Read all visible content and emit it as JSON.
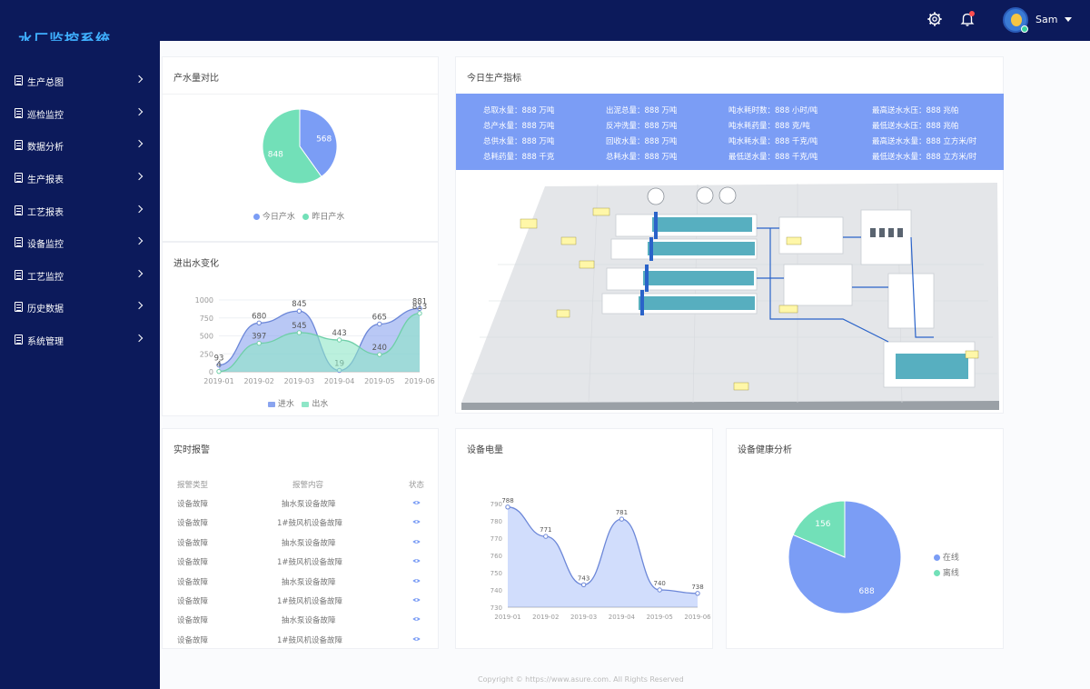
{
  "app": {
    "title": "水厂监控系统"
  },
  "header": {
    "user_name": "Sam"
  },
  "sidebar": {
    "items": [
      {
        "label": "生产总图"
      },
      {
        "label": "巡检监控"
      },
      {
        "label": "数据分析"
      },
      {
        "label": "生产报表"
      },
      {
        "label": "工艺报表"
      },
      {
        "label": "设备监控"
      },
      {
        "label": "工艺监控"
      },
      {
        "label": "历史数据"
      },
      {
        "label": "系统管理"
      }
    ]
  },
  "cards": {
    "water_compare": {
      "title": "产水量对比",
      "legend": [
        "今日产水",
        "昨日产水"
      ]
    },
    "inout": {
      "title": "进出水变化",
      "legend": [
        "进水",
        "出水"
      ]
    },
    "production": {
      "title": "今日生产指标"
    },
    "alarm": {
      "title": "实时报警"
    },
    "power": {
      "title": "设备电量"
    },
    "health": {
      "title": "设备健康分析",
      "legend": [
        "在线",
        "离线"
      ]
    }
  },
  "metrics": {
    "rows": [
      [
        "总取水量：888 万吨",
        "出泥总量：888 万吨",
        "吨水耗时数：888 小时/吨",
        "最高送水水压：888 兆帕"
      ],
      [
        "总产水量：888 万吨",
        "反冲洗量：888 万吨",
        "吨水耗药量：888 克/吨",
        "最低送水水压：888 兆帕"
      ],
      [
        "总供水量：888 万吨",
        "回收水量：888 万吨",
        "吨水耗水量：888 千克/吨",
        "最高送水水量：888 立方米/时"
      ],
      [
        "总耗药量：888 千克",
        "总耗水量：888 万吨",
        "最低送水量：888 千克/吨",
        "最低送水水量：888 立方米/时"
      ]
    ]
  },
  "alarm_table": {
    "headers": [
      "报警类型",
      "报警内容",
      "状态"
    ],
    "rows": [
      [
        "设备故障",
        "抽水泵设备故障"
      ],
      [
        "设备故障",
        "1#鼓风机设备故障"
      ],
      [
        "设备故障",
        "抽水泵设备故障"
      ],
      [
        "设备故障",
        "1#鼓风机设备故障"
      ],
      [
        "设备故障",
        "抽水泵设备故障"
      ],
      [
        "设备故障",
        "1#鼓风机设备故障"
      ],
      [
        "设备故障",
        "抽水泵设备故障"
      ],
      [
        "设备故障",
        "1#鼓风机设备故障"
      ]
    ]
  },
  "colors": {
    "sidebar_bg": "#0c1a5b",
    "title_blue": "#3fb0ff",
    "series_blue": "#7b9df5",
    "series_green": "#72e0b8"
  },
  "footer": {
    "copyright": "Copyright © https://www.asure.com. All Rights Reserved"
  },
  "chart_data": [
    {
      "type": "pie",
      "title": "产水量对比",
      "labels": [
        "今日产水",
        "昨日产水"
      ],
      "values": [
        568,
        848
      ],
      "colors": [
        "#7b9df5",
        "#72e0b8"
      ],
      "legend": "bottom"
    },
    {
      "type": "area",
      "title": "进出水变化",
      "categories": [
        "2019-01",
        "2019-02",
        "2019-03",
        "2019-04",
        "2019-05",
        "2019-06"
      ],
      "series": [
        {
          "name": "进水",
          "values": [
            93,
            680,
            845,
            19,
            665,
            881
          ],
          "color": "#8aa4ef"
        },
        {
          "name": "出水",
          "values": [
            4,
            397,
            545,
            443,
            240,
            813
          ],
          "color": "#8ee6c7"
        }
      ],
      "ylim": [
        0,
        1000
      ],
      "yticks": [
        0,
        250,
        500,
        750,
        1000
      ],
      "grid": true,
      "legend": "bottom"
    },
    {
      "type": "area",
      "title": "设备电量",
      "categories": [
        "2019-01",
        "2019-02",
        "2019-03",
        "2019-04",
        "2019-05",
        "2019-06"
      ],
      "series": [
        {
          "values": [
            788,
            771,
            743,
            781,
            740,
            738
          ],
          "color": "#7b9df5"
        }
      ],
      "ylim": [
        730,
        790
      ],
      "yticks": [
        730,
        740,
        750,
        760,
        770,
        780,
        790
      ],
      "grid": false
    },
    {
      "type": "pie",
      "title": "设备健康分析",
      "labels": [
        "在线",
        "离线"
      ],
      "values": [
        688,
        156
      ],
      "colors": [
        "#7b9df5",
        "#72e0b8"
      ],
      "legend": "right"
    }
  ]
}
